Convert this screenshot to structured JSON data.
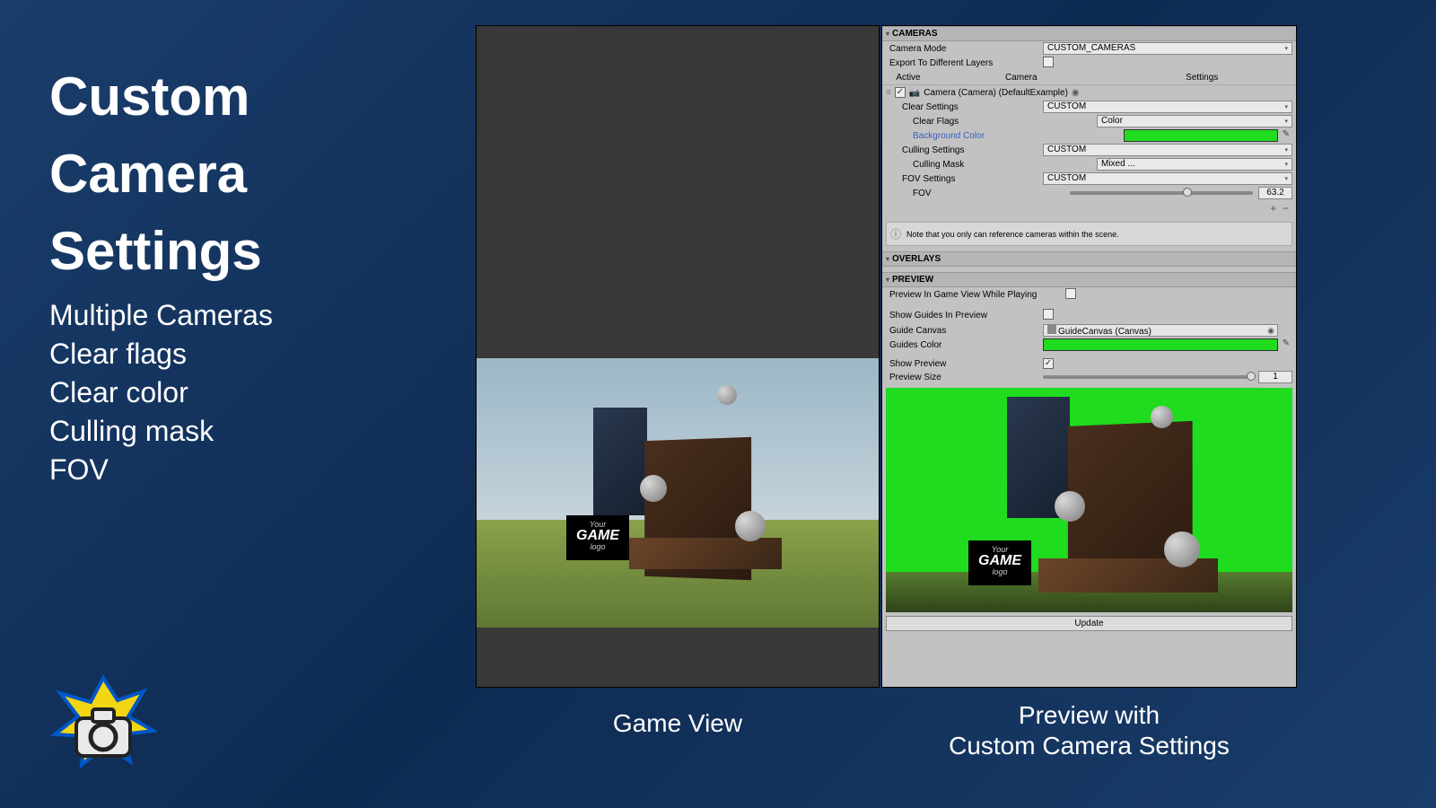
{
  "title": {
    "l1": "Custom",
    "l2": "Camera",
    "l3": "Settings"
  },
  "bullets": [
    "Multiple Cameras",
    "Clear flags",
    "Clear color",
    "Culling mask",
    "FOV"
  ],
  "captions": {
    "gameview": "Game View",
    "preview_l1": "Preview with",
    "preview_l2": "Custom Camera Settings"
  },
  "billboard": {
    "your": "Your",
    "game": "GAME",
    "logo": "logo"
  },
  "inspector": {
    "sections": {
      "cameras": "CAMERAS",
      "overlays": "OVERLAYS",
      "preview": "PREVIEW"
    },
    "camera_mode": {
      "label": "Camera Mode",
      "value": "CUSTOM_CAMERAS"
    },
    "export_layers": {
      "label": "Export To Different Layers",
      "checked": false
    },
    "table_hdr": {
      "active": "Active",
      "camera": "Camera",
      "settings": "Settings"
    },
    "camera_entry": {
      "active": true,
      "name": "Camera (Camera) (DefaultExample)"
    },
    "clear_settings": {
      "label": "Clear Settings",
      "value": "CUSTOM"
    },
    "clear_flags": {
      "label": "Clear Flags",
      "value": "Color"
    },
    "background_color": {
      "label": "Background Color",
      "hex": "#1fdc1f"
    },
    "culling_settings": {
      "label": "Culling Settings",
      "value": "CUSTOM"
    },
    "culling_mask": {
      "label": "Culling Mask",
      "value": "Mixed ..."
    },
    "fov_settings": {
      "label": "FOV Settings",
      "value": "CUSTOM"
    },
    "fov": {
      "label": "FOV",
      "value": "63.2",
      "percent": 62
    },
    "note": "Note that you only can reference cameras within the scene.",
    "preview_in_game": {
      "label": "Preview In Game View While Playing",
      "checked": false
    },
    "show_guides": {
      "label": "Show Guides In Preview",
      "checked": false
    },
    "guide_canvas": {
      "label": "Guide Canvas",
      "value": "GuideCanvas (Canvas)"
    },
    "guides_color": {
      "label": "Guides Color",
      "hex": "#1fdc1f"
    },
    "show_preview": {
      "label": "Show Preview",
      "checked": true
    },
    "preview_size": {
      "label": "Preview Size",
      "value": "1",
      "percent": 97
    },
    "update_btn": "Update"
  }
}
